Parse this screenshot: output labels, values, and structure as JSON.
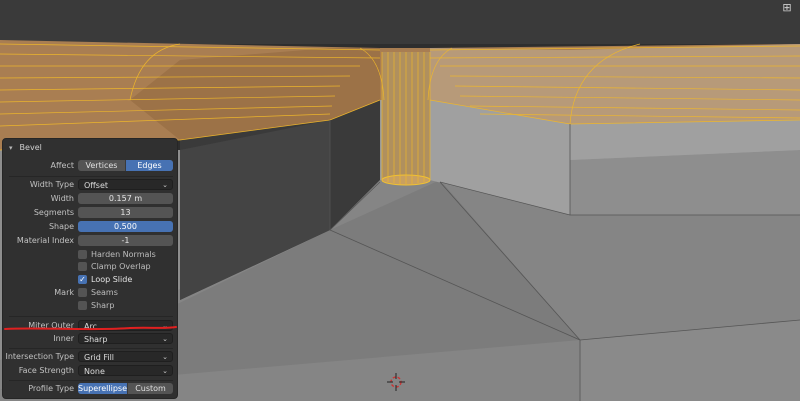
{
  "viewport": {
    "gizmo_icon": "grid-icon"
  },
  "panel": {
    "title": "Bevel",
    "collapse_icon": "chevron-down-icon",
    "affect": {
      "label": "Affect",
      "options": [
        "Vertices",
        "Edges"
      ],
      "selected": "Edges"
    },
    "width_type": {
      "label": "Width Type",
      "value": "Offset"
    },
    "width": {
      "label": "Width",
      "value": "0.157 m"
    },
    "segments": {
      "label": "Segments",
      "value": "13"
    },
    "shape": {
      "label": "Shape",
      "value": "0.500"
    },
    "material_index": {
      "label": "Material Index",
      "value": "-1"
    },
    "harden_normals": {
      "label": "Harden Normals",
      "checked": false
    },
    "clamp_overlap": {
      "label": "Clamp Overlap",
      "checked": false
    },
    "loop_slide": {
      "label": "Loop Slide",
      "checked": true
    },
    "mark": {
      "label": "Mark",
      "seams": "Seams",
      "sharp": "Sharp"
    },
    "miter_outer": {
      "label": "Miter Outer",
      "value": "Arc"
    },
    "inner": {
      "label": "Inner",
      "value": "Sharp"
    },
    "intersection_type": {
      "label": "Intersection Type",
      "value": "Grid Fill"
    },
    "face_strength": {
      "label": "Face Strength",
      "value": "None"
    },
    "profile_type": {
      "label": "Profile Type",
      "options": [
        "Superellipse",
        "Custom"
      ],
      "selected": "Superellipse"
    },
    "annotation_color": "#e02020",
    "accent_color": "#4772b3"
  }
}
